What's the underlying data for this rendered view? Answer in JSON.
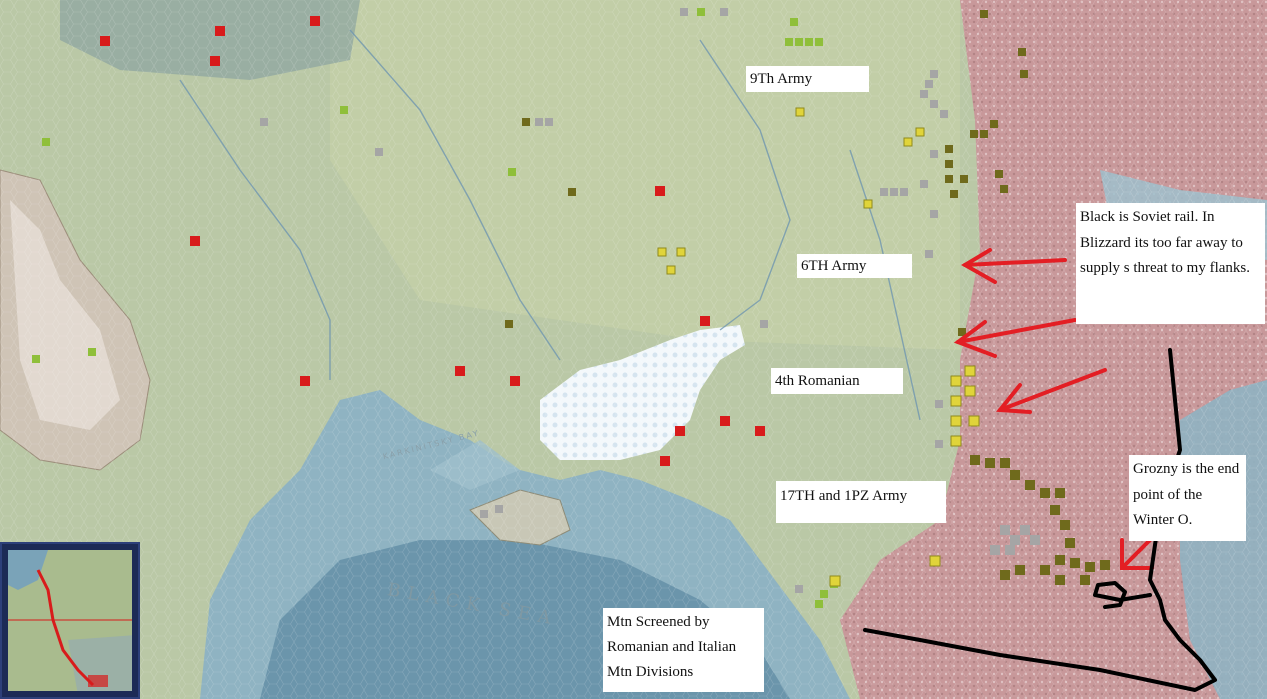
{
  "map": {
    "colors": {
      "land": "#bac8a6",
      "sea_shallow": "#8fb3c2",
      "sea_deep": "#5c88a0",
      "mountains": "#d8d2cd",
      "caucasus_zone": "#c99aa0",
      "axis_unit": "#d81b1b",
      "axis_unit_yellow": "#e0d43a",
      "soviet_unit": "#6f6a1c",
      "neutral_unit": "#9a9a9a",
      "arrow": "#e31e24",
      "annotation_line": "#000000"
    },
    "sea_labels": {
      "black_sea": "BLACK SEA",
      "karkinitsky_bay": "KARKINITSKY BAY"
    }
  },
  "annotations": {
    "ninth_army": "9Th Army",
    "sixth_army": "6TH Army",
    "fourth_romanian": "4th Romanian",
    "seventeenth_army": "17TH and 1PZ Army",
    "soviet_rail_note": "Black is Soviet rail. In Blizzard its too far away to supply s threat to my flanks.",
    "grozny_note": "Grozny is the end point of the Winter O.",
    "mountain_note": "Mtn Screened by Romanian and Italian Mtn Divisions"
  },
  "minimap": {
    "icon": "minimap-icon"
  }
}
